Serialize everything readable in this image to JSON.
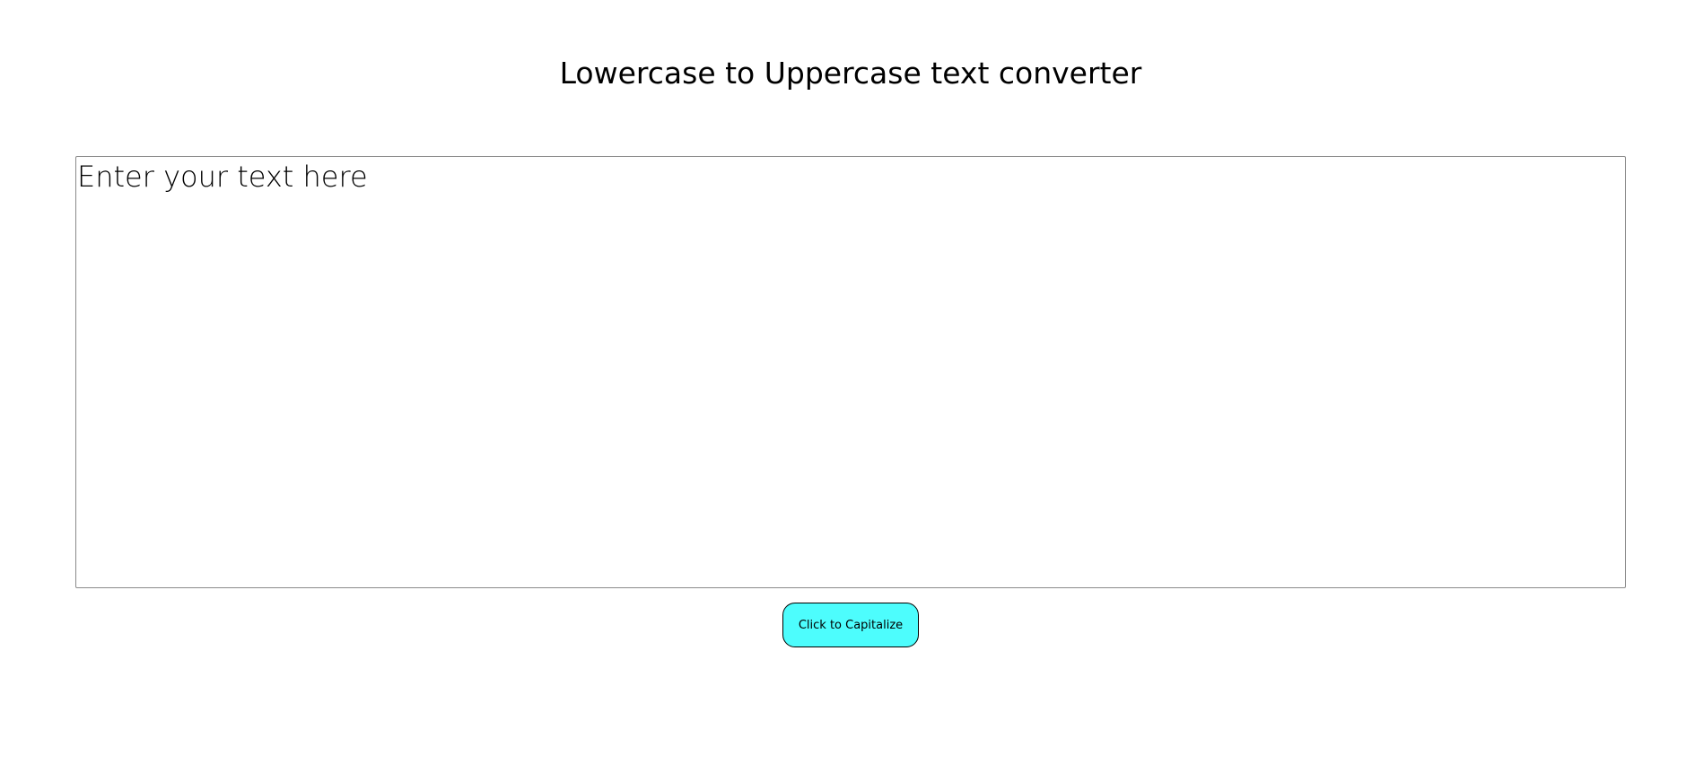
{
  "header": {
    "title": "Lowercase to Uppercase text converter"
  },
  "editor": {
    "placeholder": "Enter your text here",
    "value": ""
  },
  "actions": {
    "capitalize_label": "Click to Capitalize"
  },
  "colors": {
    "button_background": "#4dfdfd",
    "button_border": "#000000",
    "text": "#000000",
    "textarea_border": "#8a8a8a"
  }
}
